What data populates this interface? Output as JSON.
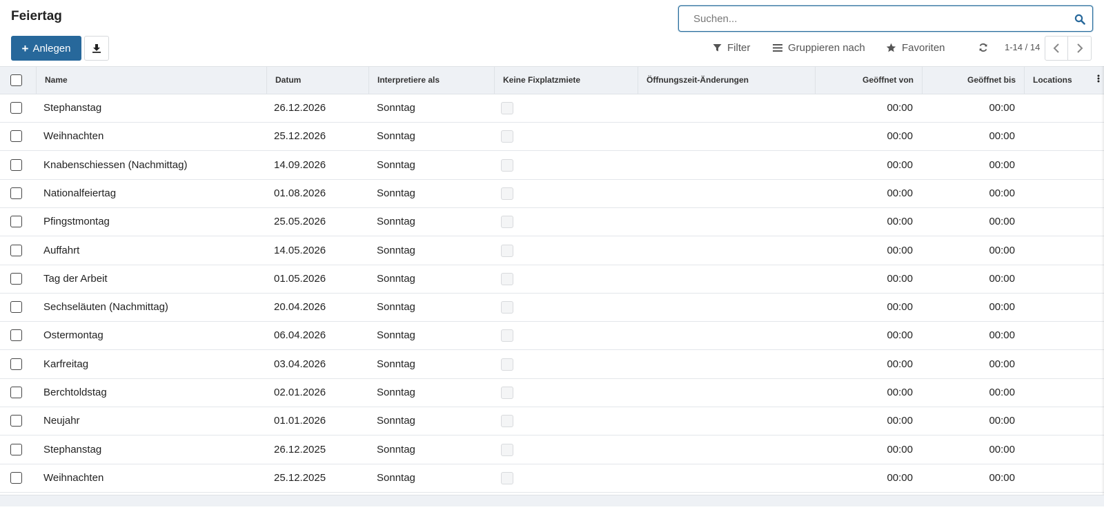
{
  "app": {
    "title": "Feiertag"
  },
  "search": {
    "placeholder": "Suchen..."
  },
  "toolbar": {
    "create_label": "Anlegen",
    "filter_label": "Filter",
    "group_label": "Gruppieren nach",
    "favorites_label": "Favoriten"
  },
  "pager": {
    "text": "1-14 / 14"
  },
  "columns": {
    "name": "Name",
    "date": "Datum",
    "interpret": "Interpretiere als",
    "no_fixed_rent": "Keine Fixplatzmiete",
    "opening_changes": "Öffnungszeit-Änderungen",
    "open_from": "Geöffnet von",
    "open_until": "Geöffnet bis",
    "locations": "Locations"
  },
  "rows": [
    {
      "name": "Stephanstag",
      "date": "26.12.2026",
      "interpret": "Sonntag",
      "open_from": "00:00",
      "open_until": "00:00"
    },
    {
      "name": "Weihnachten",
      "date": "25.12.2026",
      "interpret": "Sonntag",
      "open_from": "00:00",
      "open_until": "00:00"
    },
    {
      "name": "Knabenschiessen (Nachmittag)",
      "date": "14.09.2026",
      "interpret": "Sonntag",
      "open_from": "00:00",
      "open_until": "00:00"
    },
    {
      "name": "Nationalfeiertag",
      "date": "01.08.2026",
      "interpret": "Sonntag",
      "open_from": "00:00",
      "open_until": "00:00"
    },
    {
      "name": "Pfingstmontag",
      "date": "25.05.2026",
      "interpret": "Sonntag",
      "open_from": "00:00",
      "open_until": "00:00"
    },
    {
      "name": "Auffahrt",
      "date": "14.05.2026",
      "interpret": "Sonntag",
      "open_from": "00:00",
      "open_until": "00:00"
    },
    {
      "name": "Tag der Arbeit",
      "date": "01.05.2026",
      "interpret": "Sonntag",
      "open_from": "00:00",
      "open_until": "00:00"
    },
    {
      "name": "Sechseläuten (Nachmittag)",
      "date": "20.04.2026",
      "interpret": "Sonntag",
      "open_from": "00:00",
      "open_until": "00:00"
    },
    {
      "name": "Ostermontag",
      "date": "06.04.2026",
      "interpret": "Sonntag",
      "open_from": "00:00",
      "open_until": "00:00"
    },
    {
      "name": "Karfreitag",
      "date": "03.04.2026",
      "interpret": "Sonntag",
      "open_from": "00:00",
      "open_until": "00:00"
    },
    {
      "name": "Berchtoldstag",
      "date": "02.01.2026",
      "interpret": "Sonntag",
      "open_from": "00:00",
      "open_until": "00:00"
    },
    {
      "name": "Neujahr",
      "date": "01.01.2026",
      "interpret": "Sonntag",
      "open_from": "00:00",
      "open_until": "00:00"
    },
    {
      "name": "Stephanstag",
      "date": "26.12.2025",
      "interpret": "Sonntag",
      "open_from": "00:00",
      "open_until": "00:00"
    },
    {
      "name": "Weihnachten",
      "date": "25.12.2025",
      "interpret": "Sonntag",
      "open_from": "00:00",
      "open_until": "00:00"
    }
  ],
  "colors": {
    "primary": "#27689b",
    "header_bg": "#eef1f5",
    "border": "#dee2e6"
  },
  "icons": {
    "search": "search-icon",
    "plus": "plus-icon",
    "download": "download-icon",
    "filter": "filter-icon",
    "group": "list-icon",
    "favorites": "star-icon",
    "refresh": "refresh-icon",
    "prev": "chevron-left-icon",
    "next": "chevron-right-icon",
    "column_options": "more-vertical-icon"
  }
}
